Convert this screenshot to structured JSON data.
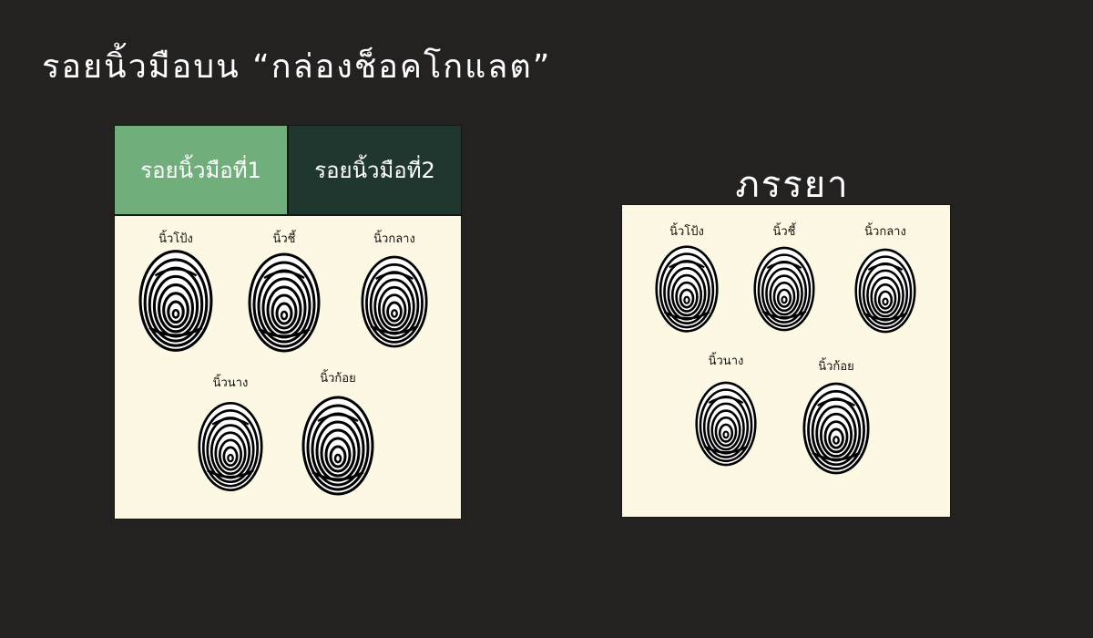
{
  "page": {
    "title": "รอยนิ้วมือบน “กล่องช็อคโกแลต”"
  },
  "left_panel": {
    "tabs": [
      {
        "label": "รอยนิ้วมือที่1",
        "color": "#70ae7c"
      },
      {
        "label": "รอยนิ้วมือที่2",
        "color": "#20372f"
      }
    ],
    "fingers": {
      "thumb": "นิ้วโป้ง",
      "index": "นิ้วชี้",
      "middle": "นิ้วกลาง",
      "ring": "นิ้วนาง",
      "little": "นิ้วก้อย"
    }
  },
  "right_panel": {
    "title": "ภรรยา",
    "fingers": {
      "thumb": "นิ้วโป้ง",
      "index": "นิ้วชี้",
      "middle": "นิ้วกลาง",
      "ring": "นิ้วนาง",
      "little": "นิ้วก้อย"
    }
  },
  "colors": {
    "background": "#242121",
    "panel": "#fdf8e4",
    "ink": "#111111"
  },
  "icons": {
    "fingerprint": "fingerprint-icon"
  }
}
